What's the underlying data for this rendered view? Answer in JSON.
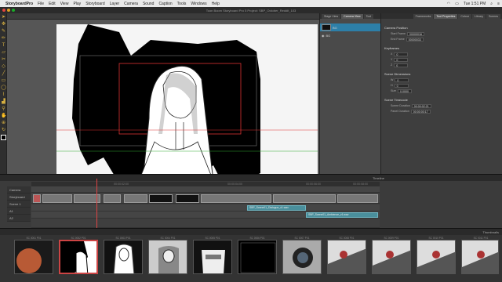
{
  "menubar": {
    "app": "StoryboardPro",
    "items": [
      "File",
      "Edit",
      "View",
      "Play",
      "Storyboard",
      "Layer",
      "Camera",
      "Sound",
      "Caption",
      "Tools",
      "Windows",
      "Help"
    ],
    "clock": "Tue 1:51 PM"
  },
  "window": {
    "title": "Toon Boom Storyboard Pro 5 Project: SBP_October_Reddit_103"
  },
  "stage": {
    "footer": "Sample Position"
  },
  "library": {
    "tabs": [
      "Stage View",
      "Camera View",
      "Tool"
    ],
    "layers": [
      {
        "name": "BG"
      },
      {
        "name": "BG"
      }
    ]
  },
  "properties": {
    "tabs": [
      "Frameworks",
      "Tool Properties",
      "Colour",
      "Library",
      "Scenes"
    ],
    "sections": [
      {
        "title": "Camera Position",
        "fields": [
          {
            "label": "Start Frame",
            "value": "00000016"
          },
          {
            "label": "End Frame",
            "value": "00000033"
          }
        ]
      },
      {
        "title": "Keyframes",
        "fields": [
          {
            "label": "X",
            "value": "0"
          },
          {
            "label": "Y",
            "value": "0"
          },
          {
            "label": "Z",
            "value": "0"
          }
        ]
      },
      {
        "title": "Scene Dimensions",
        "fields": [
          {
            "label": "W",
            "value": "0"
          },
          {
            "label": "H",
            "value": "0"
          },
          {
            "label": "Size",
            "value": "0.0000"
          }
        ]
      },
      {
        "title": "Scene Timecode",
        "fields": [
          {
            "label": "Scene Duration",
            "value": "00:00:02:21"
          },
          {
            "label": "Panel Duration",
            "value": "00:00:00:17"
          }
        ]
      }
    ]
  },
  "timeline": {
    "header": "Timeline",
    "tracks": [
      "Camera",
      "Storyboard",
      "Scene 1",
      "A1",
      "A2"
    ],
    "ruler_marks": [
      "00:00:02:00",
      "00:00:04:00",
      "00:00:06:00",
      "00:00:08:00"
    ],
    "audio_clips": [
      "SBP_Scene01_Dialogue_v1.wav",
      "SBP_Scene01_Ambience_v1.wav"
    ]
  },
  "thumbnails": {
    "header": "Thumbnails",
    "items": [
      {
        "label": "SC 0001 P01"
      },
      {
        "label": "SC 0002 P01"
      },
      {
        "label": "SC 0003 P01"
      },
      {
        "label": "SC 0004 P01"
      },
      {
        "label": "SC 0005 P01"
      },
      {
        "label": "SC 0006 P01"
      },
      {
        "label": "SC 0007 P01"
      },
      {
        "label": "SC 0008 P01"
      },
      {
        "label": "SC 0009 P01"
      },
      {
        "label": "SC 0010 P01"
      },
      {
        "label": "SC 0011 P01"
      }
    ]
  },
  "colors": {
    "accent": "#2d7fa8",
    "playhead": "#d44444",
    "tool_yellow": "#d7b040",
    "clip_teal": "#4a8f9c"
  }
}
